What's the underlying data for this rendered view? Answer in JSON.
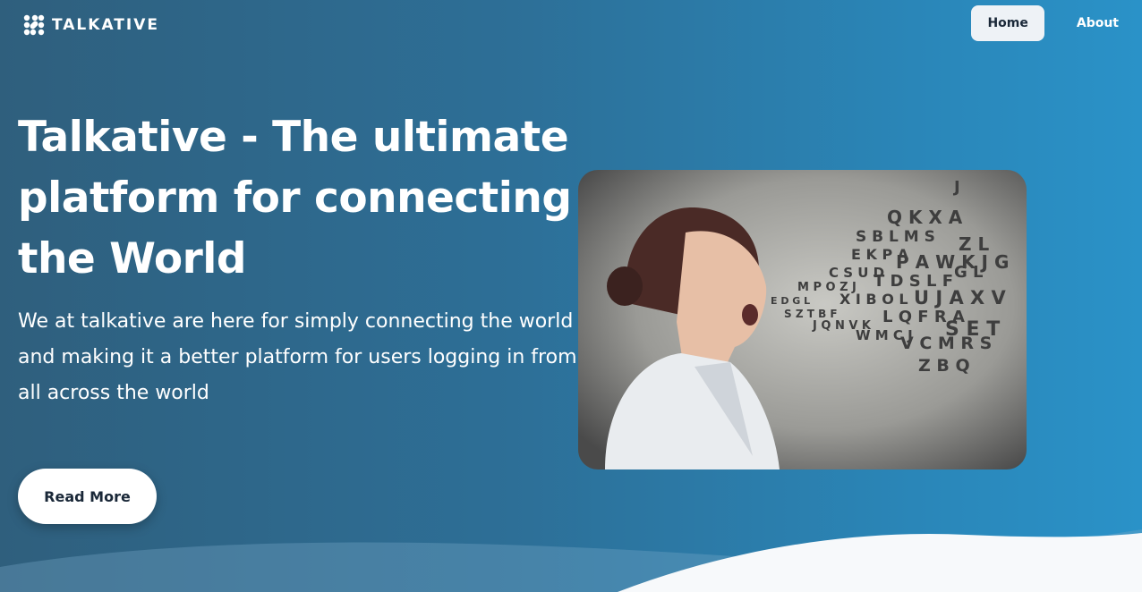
{
  "brand": {
    "name": "TALKATIVE"
  },
  "nav": {
    "home_label": "Home",
    "about_label": "About"
  },
  "hero": {
    "headline": "Talkative - The ultimate platform for connecting the World",
    "lead": "We at talkative are here for simply connecting the world and making it a better platform for users logging in from all across the world",
    "cta_label": "Read More"
  },
  "colors": {
    "accent": "#2a86b8",
    "nav_active_bg": "#eef2f6",
    "text_dark": "#1a2838"
  },
  "icons": {
    "logo": "talkative-logo-icon"
  }
}
